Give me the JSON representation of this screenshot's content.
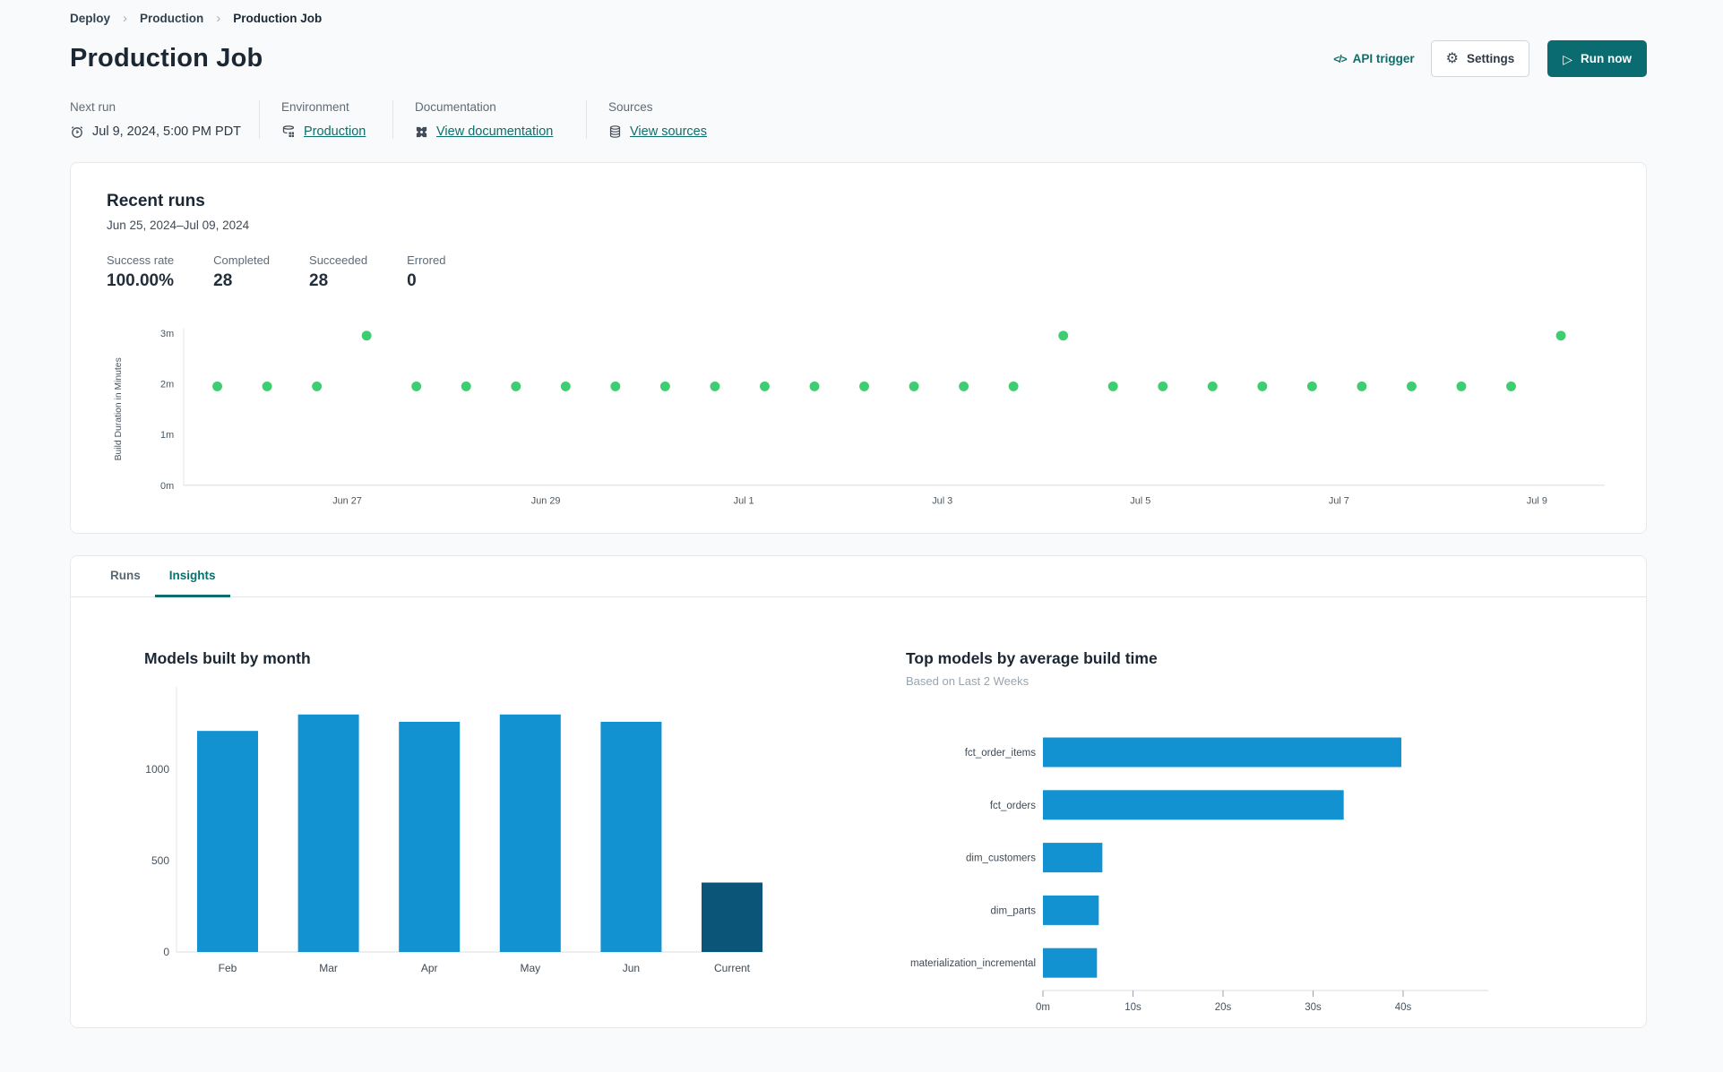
{
  "breadcrumb": {
    "items": [
      "Deploy",
      "Production",
      "Production Job"
    ]
  },
  "header": {
    "title": "Production Job",
    "api_trigger_label": "API trigger",
    "settings_label": "Settings",
    "run_now_label": "Run now"
  },
  "info": {
    "next_run": {
      "label": "Next run",
      "value": "Jul 9, 2024, 5:00 PM PDT"
    },
    "environment": {
      "label": "Environment",
      "value": "Production"
    },
    "documentation": {
      "label": "Documentation",
      "value": "View documentation"
    },
    "sources": {
      "label": "Sources",
      "value": "View sources"
    }
  },
  "recent_runs": {
    "title": "Recent runs",
    "date_range": "Jun 25, 2024–Jul 09, 2024",
    "stats": [
      {
        "label": "Success rate",
        "value": "100.00%"
      },
      {
        "label": "Completed",
        "value": "28"
      },
      {
        "label": "Succeeded",
        "value": "28"
      },
      {
        "label": "Errored",
        "value": "0"
      }
    ]
  },
  "tabs": [
    {
      "label": "Runs",
      "active": false
    },
    {
      "label": "Insights",
      "active": true
    }
  ],
  "colors": {
    "accent_teal": "#0b6f6b",
    "run_now_button": "#0a6c70",
    "run_dot_green": "#3ecd71",
    "bar_blue": "#1292d0",
    "bar_dark_blue": "#0b5578"
  },
  "chart_data": [
    {
      "id": "build-duration-by-run",
      "type": "scatter",
      "title": "Recent runs",
      "ylabel": "Build Duration in Minutes",
      "yticks": [
        "0m",
        "1m",
        "2m",
        "3m"
      ],
      "ylim_minutes": [
        0,
        3.2
      ],
      "xticks": [
        {
          "x": 2.61,
          "label": "Jun 27"
        },
        {
          "x": 6.6,
          "label": "Jun 29"
        },
        {
          "x": 10.58,
          "label": "Jul 1"
        },
        {
          "x": 14.57,
          "label": "Jul 3"
        },
        {
          "x": 18.55,
          "label": "Jul 5"
        },
        {
          "x": 22.54,
          "label": "Jul 7"
        },
        {
          "x": 26.52,
          "label": "Jul 9"
        }
      ],
      "durations_minutes": [
        1.95,
        1.95,
        1.95,
        2.95,
        1.95,
        1.95,
        1.95,
        1.95,
        1.95,
        1.95,
        1.95,
        1.95,
        1.95,
        1.95,
        1.95,
        1.95,
        1.95,
        2.95,
        1.95,
        1.95,
        1.95,
        1.95,
        1.95,
        1.95,
        1.95,
        1.95,
        1.95,
        2.95
      ]
    },
    {
      "id": "models-built-by-month",
      "type": "bar",
      "title": "Models built by month",
      "categories": [
        "Feb",
        "Mar",
        "Apr",
        "May",
        "Jun",
        "Current"
      ],
      "values": [
        1210,
        1300,
        1260,
        1300,
        1260,
        380
      ],
      "bar_colors": [
        "#1292d0",
        "#1292d0",
        "#1292d0",
        "#1292d0",
        "#1292d0",
        "#0b5578"
      ],
      "yticks": [
        0,
        500,
        1000
      ],
      "ylim": [
        0,
        1450
      ],
      "grid": false
    },
    {
      "id": "top-models-by-avg-build-time",
      "type": "bar-horizontal",
      "title": "Top models by average build time",
      "subtitle": "Based on Last 2 Weeks",
      "categories": [
        "fct_order_items",
        "fct_orders",
        "dim_customers",
        "dim_parts",
        "materialization_incremental"
      ],
      "values_seconds": [
        39.8,
        33.4,
        6.6,
        6.2,
        6.0
      ],
      "xticks": [
        "0m",
        "10s",
        "20s",
        "30s",
        "40s"
      ],
      "xlim_seconds": [
        0,
        45
      ],
      "grid": false
    }
  ]
}
